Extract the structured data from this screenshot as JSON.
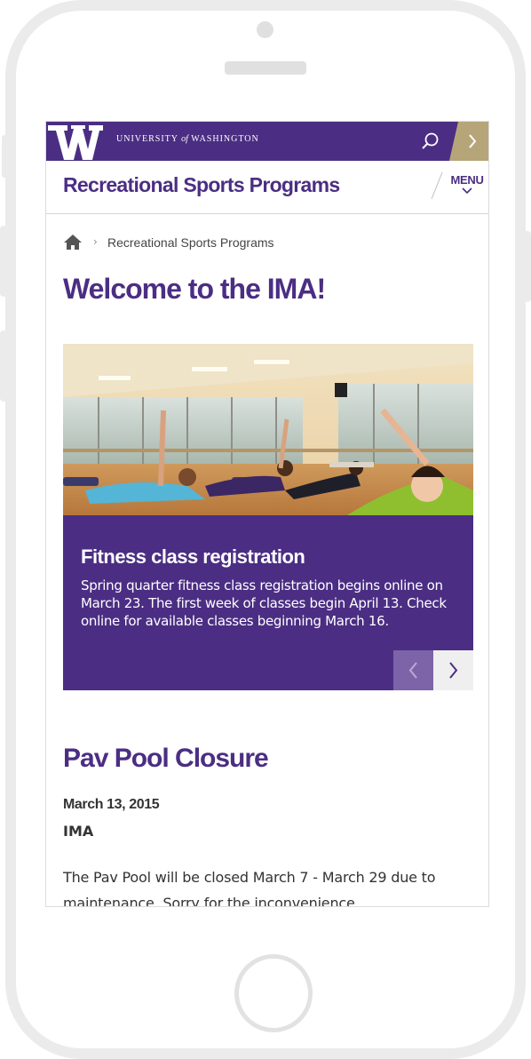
{
  "brand": {
    "logo_letter": "W",
    "university_prefix": "UNIVERSITY",
    "university_of": "of",
    "university_suffix": "WASHINGTON",
    "colors": {
      "purple": "#4b2e83",
      "gold": "#b7a57a",
      "light_purple": "#7d64a8"
    }
  },
  "topbar": {
    "search_icon": "search-icon",
    "expand_icon": "chevron-right-icon"
  },
  "header": {
    "site_title": "Recreational Sports Programs",
    "menu_label": "MENU",
    "menu_icon": "chevron-down-icon"
  },
  "breadcrumb": {
    "home_icon": "home-icon",
    "separator": "›",
    "current": "Recreational Sports Programs"
  },
  "page": {
    "title": "Welcome to the IMA!"
  },
  "slideshow": {
    "slide_title": "Fitness class registration",
    "slide_text": "Spring quarter fitness class registration begins online on March 23. The first week of classes begin April 13. Check online for available classes beginning March 16.",
    "prev_icon": "chevron-left-icon",
    "next_icon": "chevron-right-icon"
  },
  "news": {
    "title": "Pav Pool Closure",
    "date": "March 13, 2015",
    "tag": "IMA",
    "body": "The Pav Pool will be closed March 7 - March 29 due to maintenance. Sorry for the inconvenience."
  }
}
